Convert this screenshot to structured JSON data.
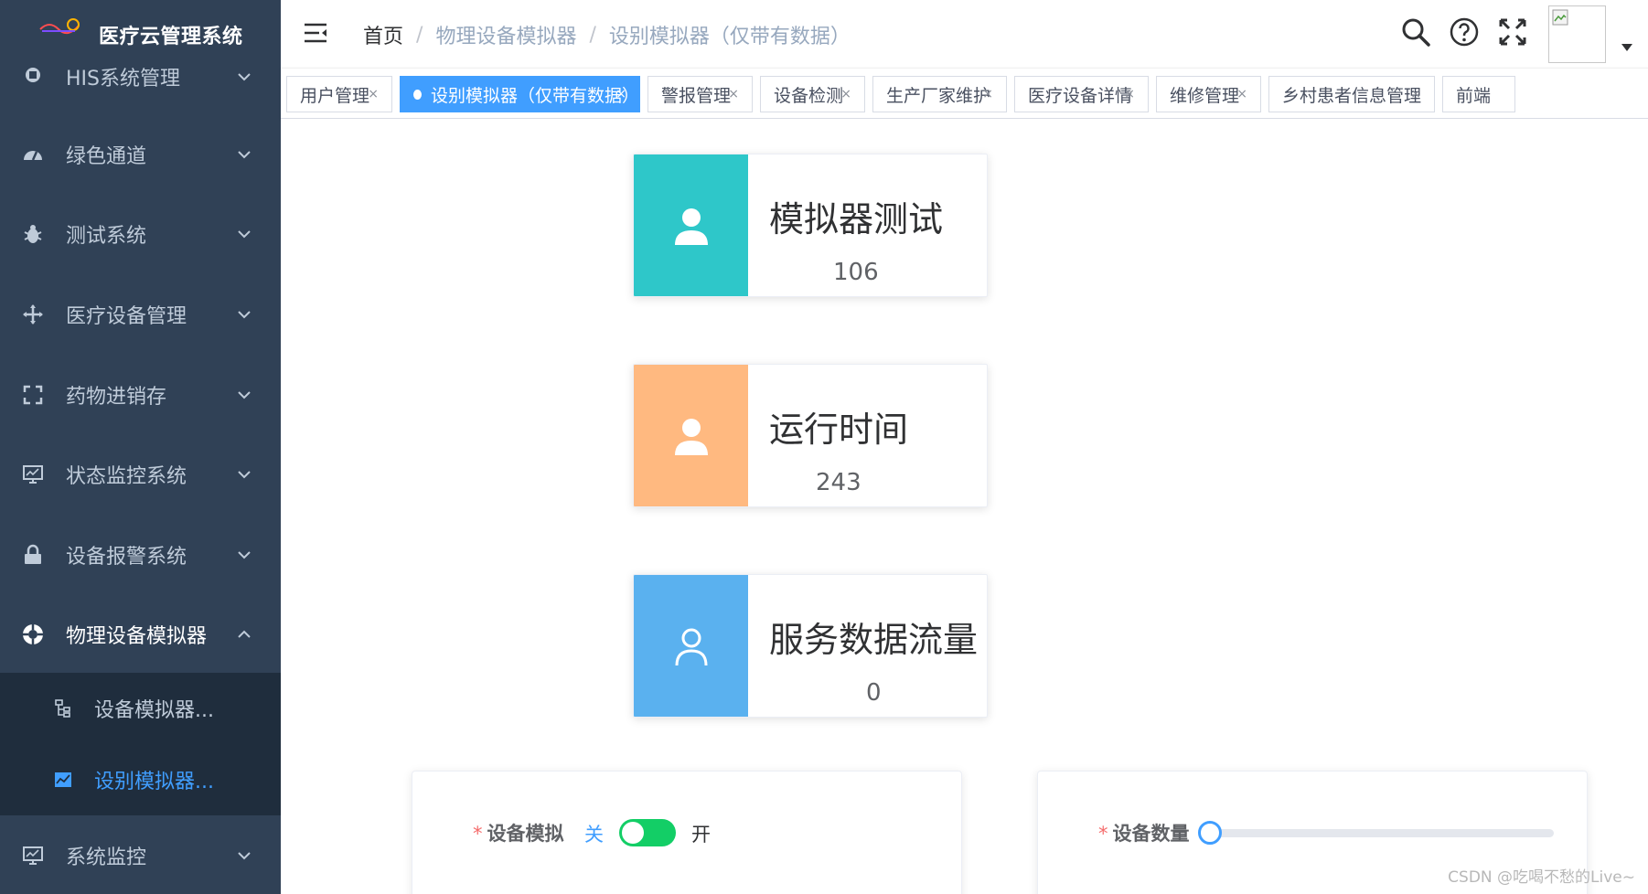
{
  "app": {
    "title": "医疗云管理系统"
  },
  "theme": {
    "sidebar_bg": "#304156",
    "submenu_bg": "#1f2d3d",
    "accent": "#409eff",
    "switch_on": "#13ce66"
  },
  "sidebar": {
    "items": [
      {
        "label": "HIS系统管理",
        "icon": "his-icon"
      },
      {
        "label": "绿色通道",
        "icon": "dashboard-icon"
      },
      {
        "label": "测试系统",
        "icon": "bug-icon"
      },
      {
        "label": "医疗设备管理",
        "icon": "move-icon"
      },
      {
        "label": "药物进销存",
        "icon": "fullscreen-icon"
      },
      {
        "label": "状态监控系统",
        "icon": "monitor-icon"
      },
      {
        "label": "设备报警系统",
        "icon": "lock-icon"
      },
      {
        "label": "物理设备模拟器",
        "icon": "lifebuoy-icon"
      },
      {
        "label": "系统监控",
        "icon": "monitor-icon"
      }
    ],
    "subitems": [
      {
        "label": "设备模拟器...",
        "icon": "tree-icon"
      },
      {
        "label": "设别模拟器...",
        "icon": "chart-icon"
      }
    ]
  },
  "breadcrumb": {
    "home": "首页",
    "items": [
      "物理设备模拟器",
      "设别模拟器（仅带有数据）"
    ],
    "separator": "/"
  },
  "tags": [
    {
      "label": "用户管理"
    },
    {
      "label": "设别模拟器（仅带有数据）"
    },
    {
      "label": "警报管理"
    },
    {
      "label": "设备检测"
    },
    {
      "label": "生产厂家维护"
    },
    {
      "label": "医疗设备详情"
    },
    {
      "label": "维修管理"
    },
    {
      "label": "乡村患者信息管理"
    },
    {
      "label": "前端"
    }
  ],
  "tag_close": "×",
  "cards": [
    {
      "title": "模拟器测试",
      "value": "106",
      "color": "#2ec7c9"
    },
    {
      "title": "运行时间",
      "value": "243",
      "color": "#ffb980"
    },
    {
      "title": "服务数据流量",
      "value": "0",
      "color": "#5ab1ef"
    }
  ],
  "form": {
    "required_mark": "*",
    "sim_label": "设备模拟",
    "switch_off": "关",
    "switch_on": "开",
    "switch_value": true,
    "count_label": "设备数量",
    "slider_value": 0
  },
  "watermark": "CSDN @吃喝不愁的Live~"
}
